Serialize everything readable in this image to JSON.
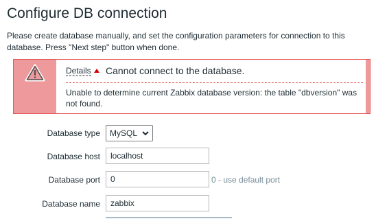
{
  "page": {
    "title": "Configure DB connection",
    "intro": "Please create database manually, and set the configuration parameters for connection to this database. Press \"Next step\" button when done."
  },
  "error": {
    "details_label": "Details",
    "headline": "Cannot connect to the database.",
    "detail": "Unable to determine current Zabbix database version: the table \"dbversion\" was not found.",
    "icon": "warning-triangle-icon",
    "colors": {
      "panel": "#ee9a9d",
      "border": "#e45959"
    }
  },
  "form": {
    "db_type": {
      "label": "Database type",
      "value": "MySQL"
    },
    "db_host": {
      "label": "Database host",
      "value": "localhost"
    },
    "db_port": {
      "label": "Database port",
      "value": "0",
      "hint": "0 - use default port"
    },
    "db_name": {
      "label": "Database name",
      "value": "zabbix"
    }
  }
}
